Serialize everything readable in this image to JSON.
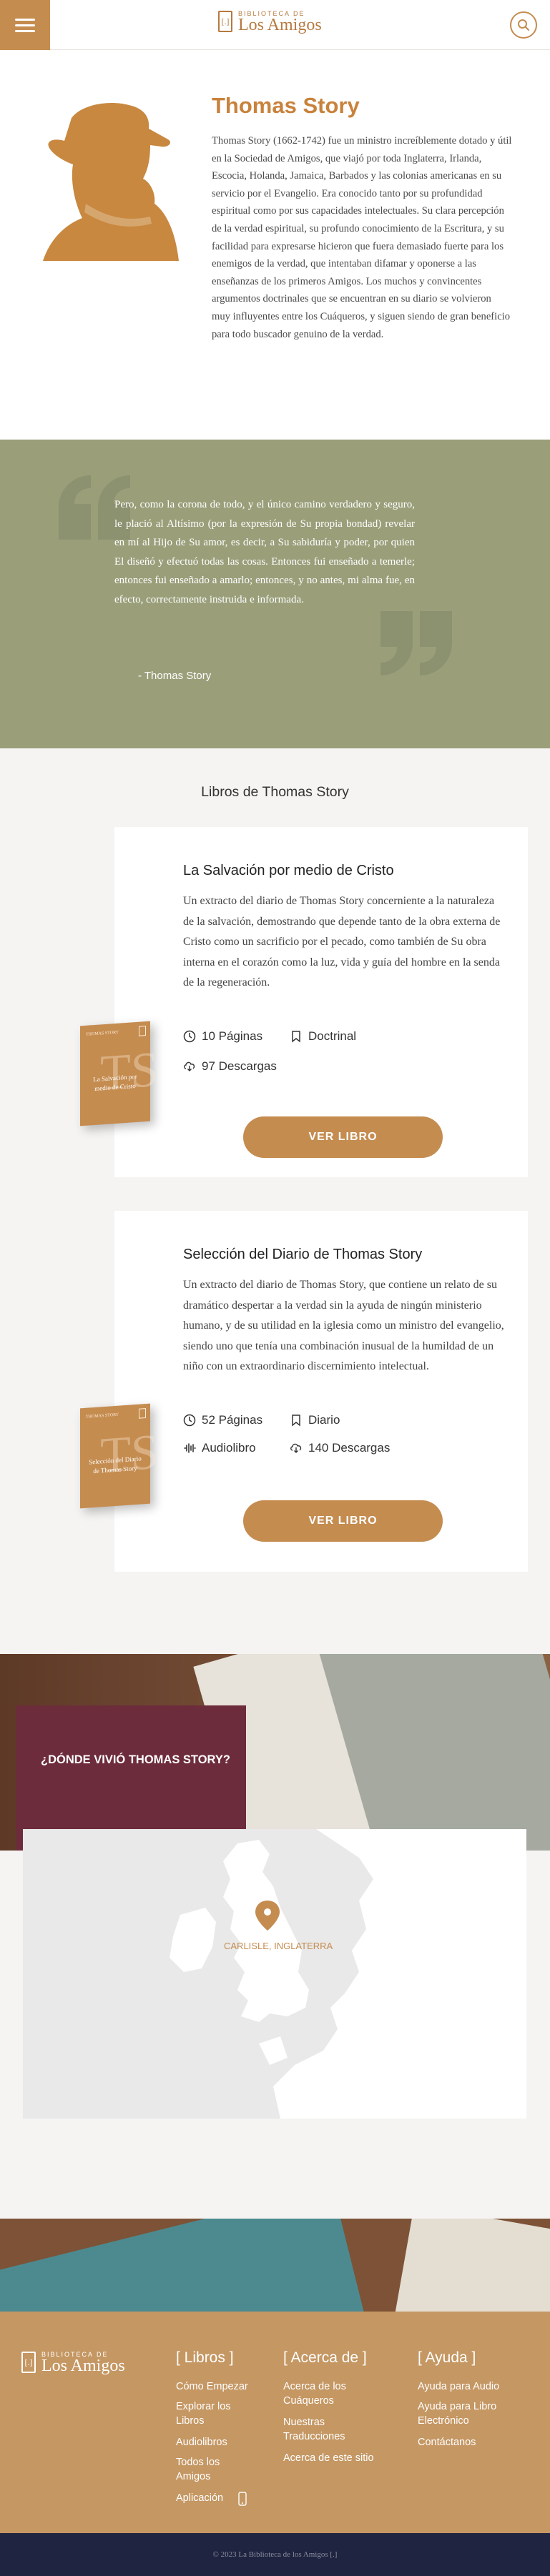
{
  "header": {
    "logo_top": "BIBLIOTECA DE",
    "logo_main": "Los Amigos",
    "logo_mark": "[.]"
  },
  "author": {
    "name": "Thomas Story",
    "bio": "Thomas Story (1662-1742) fue un ministro increíblemente dotado y útil en la Sociedad de Amigos, que viajó por toda Inglaterra, Irlanda, Escocia, Holanda, Jamaica, Barbados y las colonias americanas en su servicio por el Evangelio. Era conocido tanto por su profundidad espiritual como por sus capacidades intelectuales. Su clara percepción de la verdad espiritual, su profundo conocimiento de la Escritura, y su facilidad para expresarse hicieron que fuera demasiado fuerte para los enemigos de la verdad, que intentaban difamar y oponerse a las enseñanzas de los primeros Amigos. Los muchos y convincentes argumentos doctrinales que se encuentran en su diario se volvieron muy influyentes entre los Cuáqueros, y siguen siendo de gran beneficio para todo buscador genuino de la verdad."
  },
  "quote": {
    "text": "Pero, como la corona de todo, y el único camino verdadero y seguro, le plació al Altísimo (por la expresión de Su propia bondad) revelar en mí al Hijo de Su amor, es decir, a Su sabiduría y poder, por quien El diseñó y efectuó todas las cosas. Entonces fui enseñado a temerle; entonces fui enseñado a amarlo; entonces, y no antes, mi alma fue, en efecto, correctamente instruida e informada.",
    "author": "- Thomas Story"
  },
  "books_section": {
    "title": "Libros de Thomas Story",
    "books": [
      {
        "title": "La Salvación por medio de Cristo",
        "description": "Un extracto del diario de Thomas Story concerniente a la naturaleza de la salvación, demostrando que depende tanto de la obra externa de Cristo como un sacrificio por el pecado, como también de Su obra interna en el corazón como la luz, vida y guía del hombre en la senda de la regeneración.",
        "pages": "10 Páginas",
        "category": "Doctrinal",
        "downloads": "97 Descargas",
        "button": "VER LIBRO",
        "cover_top": "THOMAS STORY",
        "cover_letters": "TS",
        "cover_title": "La Salvación por medio de Cristo"
      },
      {
        "title": "Selección del Diario de Thomas Story",
        "description": "Un extracto del diario de Thomas Story, que contiene un relato de su dramático despertar a la verdad sin la ayuda de ningún ministerio humano, y de su utilidad en la iglesia como un ministro del evangelio, siendo uno que tenía una combinación inusual de la humildad de un niño con un extraordinario discernimiento intelectual.",
        "pages": "52 Páginas",
        "category": "Diario",
        "audio": "Audiolibro",
        "downloads": "140 Descargas",
        "button": "VER LIBRO",
        "cover_top": "THOMAS STORY",
        "cover_letters": "TS",
        "cover_title": "Selección del Diario de Thomas Story"
      }
    ]
  },
  "where": {
    "title": "¿DÓNDE VIVIÓ THOMAS STORY?"
  },
  "map": {
    "pin_label": "CARLISLE, INGLATERRA"
  },
  "footer": {
    "logo_top": "BIBLIOTECA DE",
    "logo_main": "Los Amigos",
    "columns": [
      {
        "title": "[ Libros ]",
        "links": [
          "Cómo Empezar",
          "Explorar los Libros",
          "Audiolibros",
          "Todos los Amigos",
          "Aplicación"
        ]
      },
      {
        "title": "[ Acerca de ]",
        "links": [
          "Acerca de los Cuáqueros",
          "Nuestras Traducciones",
          "Acerca de este sitio"
        ]
      },
      {
        "title": "[ Ayuda ]",
        "links": [
          "Ayuda para Audio",
          "Ayuda para Libro Electrónico",
          "Contáctanos"
        ]
      }
    ],
    "copyright": "© 2023 La Biblioteca de los Amigos [.]"
  },
  "colors": {
    "accent": "#c58c50",
    "quote_bg": "#9a9f7a",
    "where_box": "#6d2c3c",
    "footer_bg": "#c59763",
    "copy_bg": "#1f2440"
  }
}
